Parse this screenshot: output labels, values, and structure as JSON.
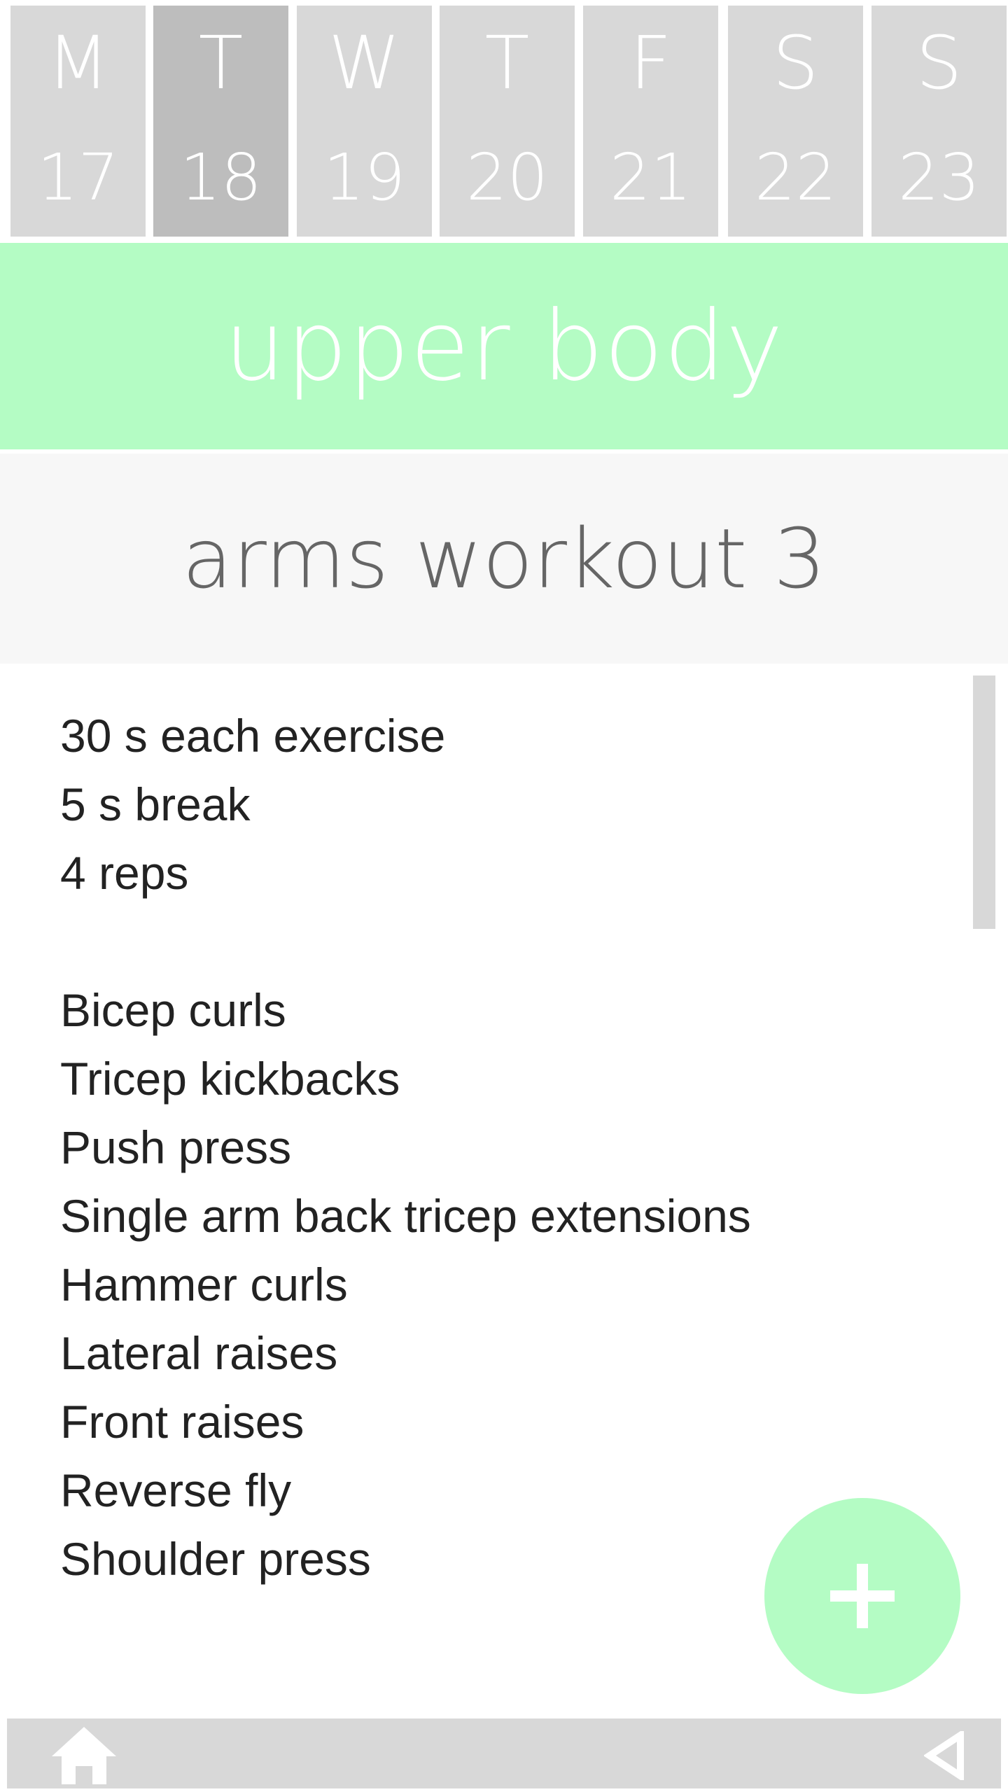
{
  "week": {
    "days": [
      {
        "letter": "M",
        "date": "17"
      },
      {
        "letter": "T",
        "date": "18"
      },
      {
        "letter": "W",
        "date": "19"
      },
      {
        "letter": "T",
        "date": "20"
      },
      {
        "letter": "F",
        "date": "21"
      },
      {
        "letter": "S",
        "date": "22"
      },
      {
        "letter": "S",
        "date": "23"
      }
    ],
    "selected_date": "18"
  },
  "category": {
    "label": "upper body",
    "color": "#b4fcc4"
  },
  "workout": {
    "title": "arms workout 3",
    "details": [
      "30 s each exercise",
      "5 s break",
      "4 reps",
      "",
      "Bicep curls",
      "Tricep kickbacks",
      "Push press",
      "Single arm back tricep extensions",
      "Hammer curls",
      "Lateral raises",
      "Front raises",
      "Reverse fly",
      "Shoulder press"
    ]
  },
  "fab": {
    "icon": "plus-icon"
  },
  "nav": {
    "home_icon": "home-icon",
    "back_icon": "back-triangle-icon"
  },
  "colors": {
    "accent": "#b4fcc4",
    "day_tile": "#d8d8d8",
    "day_tile_selected": "#bdbdbd",
    "title_band": "#f7f7f7",
    "title_text": "#666666",
    "body_text": "#222222"
  }
}
